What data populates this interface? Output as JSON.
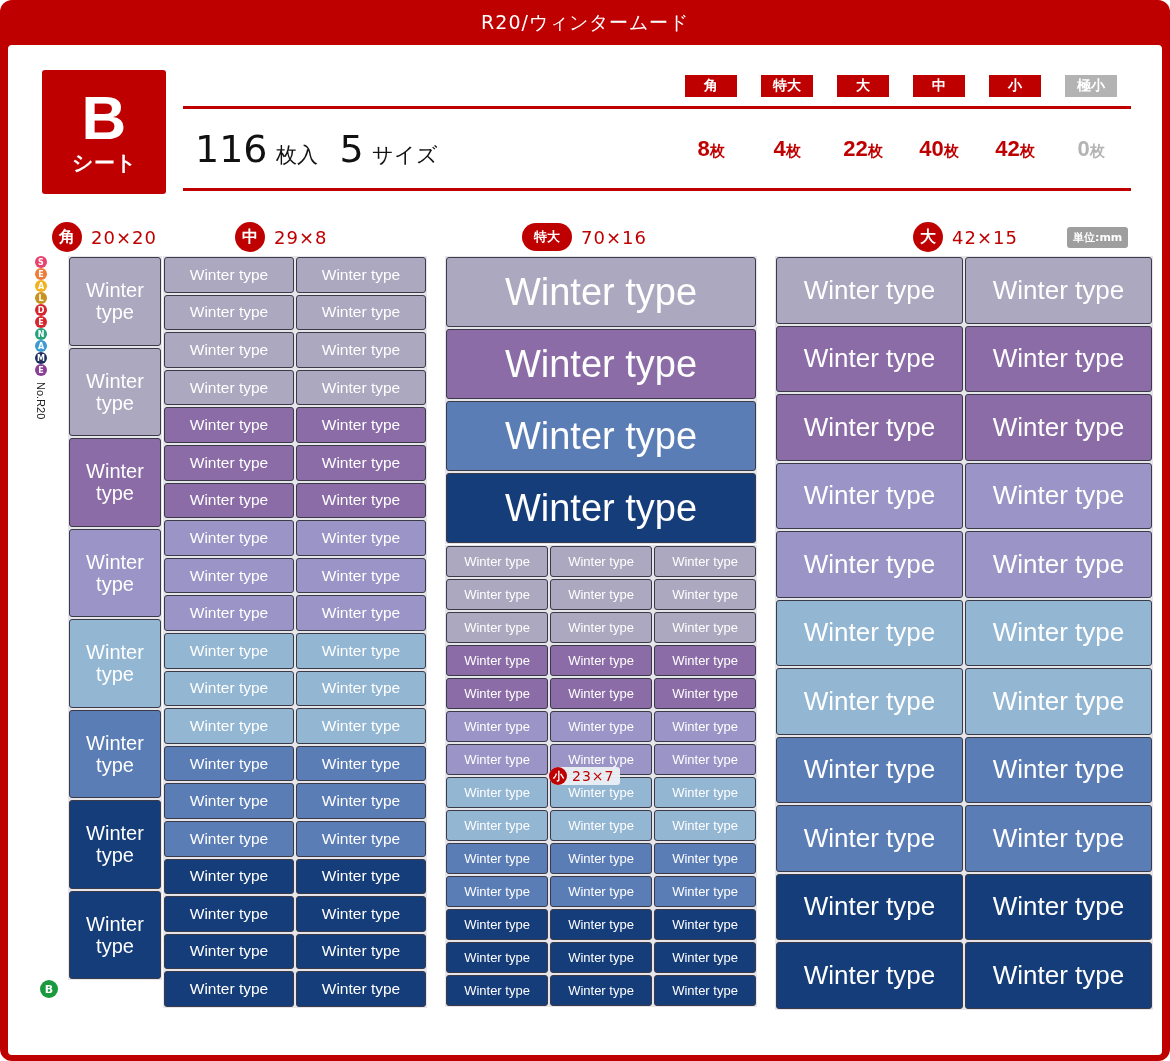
{
  "title": "R20/ウィンタームード",
  "sheet": {
    "letter": "B",
    "label": "シート"
  },
  "summary": {
    "count": "116",
    "count_unit": "枚入",
    "sizes": "5",
    "sizes_unit": "サイズ"
  },
  "sizes": [
    {
      "label": "角",
      "count": "8",
      "unit": "枚",
      "available": true
    },
    {
      "label": "特大",
      "count": "4",
      "unit": "枚",
      "available": true
    },
    {
      "label": "大",
      "count": "22",
      "unit": "枚",
      "available": true
    },
    {
      "label": "中",
      "count": "40",
      "unit": "枚",
      "available": true
    },
    {
      "label": "小",
      "count": "42",
      "unit": "枚",
      "available": true
    },
    {
      "label": "極小",
      "count": "0",
      "unit": "枚",
      "available": false
    }
  ],
  "sections": [
    {
      "badge": "角",
      "kind": "circle",
      "dimensions": "20×20"
    },
    {
      "badge": "中",
      "kind": "circle",
      "dimensions": "29×8"
    },
    {
      "badge": "特大",
      "kind": "pill",
      "dimensions": "70×16"
    },
    {
      "badge": "大",
      "kind": "circle",
      "dimensions": "42×15"
    }
  ],
  "unit_note": "単位:mm",
  "brand": {
    "letters": [
      {
        "char": "S",
        "color": "#e8416e"
      },
      {
        "char": "E",
        "color": "#ee7d3b"
      },
      {
        "char": "A",
        "color": "#f2b21c"
      },
      {
        "char": "L",
        "color": "#c79220"
      },
      {
        "char": "D",
        "color": "#d6252d"
      },
      {
        "char": "E",
        "color": "#d6252d"
      },
      {
        "char": "N",
        "color": "#27a37b"
      },
      {
        "char": "A",
        "color": "#3b9bd1"
      },
      {
        "char": "M",
        "color": "#1e2e5e"
      },
      {
        "char": "E",
        "color": "#8a3e98"
      }
    ],
    "number": "No.R20"
  },
  "sheet_mark": "B",
  "groups": [
    {
      "kind": "kaku",
      "rows": [
        {
          "color": "#aba8bf",
          "labels": [
            "Winter type"
          ]
        },
        {
          "color": "#aba8bf",
          "labels": [
            "Winter type"
          ]
        },
        {
          "color": "#8b6ca6",
          "labels": [
            "Winter type"
          ]
        },
        {
          "color": "#9b94c6",
          "labels": [
            "Winter type"
          ]
        },
        {
          "color": "#93b6d3",
          "labels": [
            "Winter type"
          ]
        },
        {
          "color": "#5b7db6",
          "labels": [
            "Winter type"
          ]
        },
        {
          "color": "#153d7a",
          "labels": [
            "Winter type"
          ]
        },
        {
          "color": "#153d7a",
          "labels": [
            "Winter type"
          ]
        }
      ]
    },
    {
      "kind": "chu",
      "rows": [
        {
          "color": "#aba8bf",
          "labels": [
            "Winter type",
            "Winter type"
          ]
        },
        {
          "color": "#aba8bf",
          "labels": [
            "Winter type",
            "Winter type"
          ]
        },
        {
          "color": "#aba8bf",
          "labels": [
            "Winter type",
            "Winter type"
          ]
        },
        {
          "color": "#aba8bf",
          "labels": [
            "Winter type",
            "Winter type"
          ]
        },
        {
          "color": "#8b6ca6",
          "labels": [
            "Winter type",
            "Winter type"
          ]
        },
        {
          "color": "#8b6ca6",
          "labels": [
            "Winter type",
            "Winter type"
          ]
        },
        {
          "color": "#8b6ca6",
          "labels": [
            "Winter type",
            "Winter type"
          ]
        },
        {
          "color": "#9b94c6",
          "labels": [
            "Winter type",
            "Winter type"
          ]
        },
        {
          "color": "#9b94c6",
          "labels": [
            "Winter type",
            "Winter type"
          ]
        },
        {
          "color": "#9b94c6",
          "labels": [
            "Winter type",
            "Winter type"
          ]
        },
        {
          "color": "#93b6d3",
          "labels": [
            "Winter type",
            "Winter type"
          ]
        },
        {
          "color": "#93b6d3",
          "labels": [
            "Winter type",
            "Winter type"
          ]
        },
        {
          "color": "#93b6d3",
          "labels": [
            "Winter type",
            "Winter type"
          ]
        },
        {
          "color": "#5b7db6",
          "labels": [
            "Winter type",
            "Winter type"
          ]
        },
        {
          "color": "#5b7db6",
          "labels": [
            "Winter type",
            "Winter type"
          ]
        },
        {
          "color": "#5b7db6",
          "labels": [
            "Winter type",
            "Winter type"
          ]
        },
        {
          "color": "#153d7a",
          "labels": [
            "Winter type",
            "Winter type"
          ]
        },
        {
          "color": "#153d7a",
          "labels": [
            "Winter type",
            "Winter type"
          ]
        },
        {
          "color": "#153d7a",
          "labels": [
            "Winter type",
            "Winter type"
          ]
        },
        {
          "color": "#153d7a",
          "labels": [
            "Winter type",
            "Winter type"
          ]
        }
      ]
    },
    {
      "kind": "tokudai",
      "rows": [
        {
          "color": "#aba8bf",
          "labels": [
            "Winter type"
          ]
        },
        {
          "color": "#8b6ca6",
          "labels": [
            "Winter type"
          ]
        },
        {
          "color": "#5b7db6",
          "labels": [
            "Winter type"
          ]
        },
        {
          "color": "#153d7a",
          "labels": [
            "Winter type"
          ]
        }
      ]
    },
    {
      "kind": "sho",
      "overlay": {
        "badge": "小",
        "dimensions": "23×7"
      },
      "rows": [
        {
          "color": "#aba8bf",
          "labels": [
            "Winter type",
            "Winter type",
            "Winter type"
          ]
        },
        {
          "color": "#aba8bf",
          "labels": [
            "Winter type",
            "Winter type",
            "Winter type"
          ]
        },
        {
          "color": "#aba8bf",
          "labels": [
            "Winter type",
            "Winter type",
            "Winter type"
          ]
        },
        {
          "color": "#8b6ca6",
          "labels": [
            "Winter type",
            "Winter type",
            "Winter type"
          ]
        },
        {
          "color": "#8b6ca6",
          "labels": [
            "Winter type",
            "Winter type",
            "Winter type"
          ]
        },
        {
          "color": "#9b94c6",
          "labels": [
            "Winter type",
            "Winter type",
            "Winter type"
          ]
        },
        {
          "color": "#9b94c6",
          "labels": [
            "Winter type",
            "Winter type",
            "Winter type"
          ]
        },
        {
          "color": "#93b6d3",
          "labels": [
            "Winter type",
            "Winter type",
            "Winter type"
          ]
        },
        {
          "color": "#93b6d3",
          "labels": [
            "Winter type",
            "Winter type",
            "Winter type"
          ]
        },
        {
          "color": "#5b7db6",
          "labels": [
            "Winter type",
            "Winter type",
            "Winter type"
          ]
        },
        {
          "color": "#5b7db6",
          "labels": [
            "Winter type",
            "Winter type",
            "Winter type"
          ]
        },
        {
          "color": "#153d7a",
          "labels": [
            "Winter type",
            "Winter type",
            "Winter type"
          ]
        },
        {
          "color": "#153d7a",
          "labels": [
            "Winter type",
            "Winter type",
            "Winter type"
          ]
        },
        {
          "color": "#153d7a",
          "labels": [
            "Winter type",
            "Winter type",
            "Winter type"
          ]
        }
      ]
    },
    {
      "kind": "dai",
      "rows": [
        {
          "color": "#aba8bf",
          "labels": [
            "Winter type",
            "Winter type"
          ]
        },
        {
          "color": "#8b6ca6",
          "labels": [
            "Winter type",
            "Winter type"
          ]
        },
        {
          "color": "#8b6ca6",
          "labels": [
            "Winter type",
            "Winter type"
          ]
        },
        {
          "color": "#9b94c6",
          "labels": [
            "Winter type",
            "Winter type"
          ]
        },
        {
          "color": "#9b94c6",
          "labels": [
            "Winter type",
            "Winter type"
          ]
        },
        {
          "color": "#93b6d3",
          "labels": [
            "Winter type",
            "Winter type"
          ]
        },
        {
          "color": "#93b6d3",
          "labels": [
            "Winter type",
            "Winter type"
          ]
        },
        {
          "color": "#5b7db6",
          "labels": [
            "Winter type",
            "Winter type"
          ]
        },
        {
          "color": "#5b7db6",
          "labels": [
            "Winter type",
            "Winter type"
          ]
        },
        {
          "color": "#153d7a",
          "labels": [
            "Winter type",
            "Winter type"
          ]
        },
        {
          "color": "#153d7a",
          "labels": [
            "Winter type",
            "Winter type"
          ]
        }
      ]
    }
  ]
}
